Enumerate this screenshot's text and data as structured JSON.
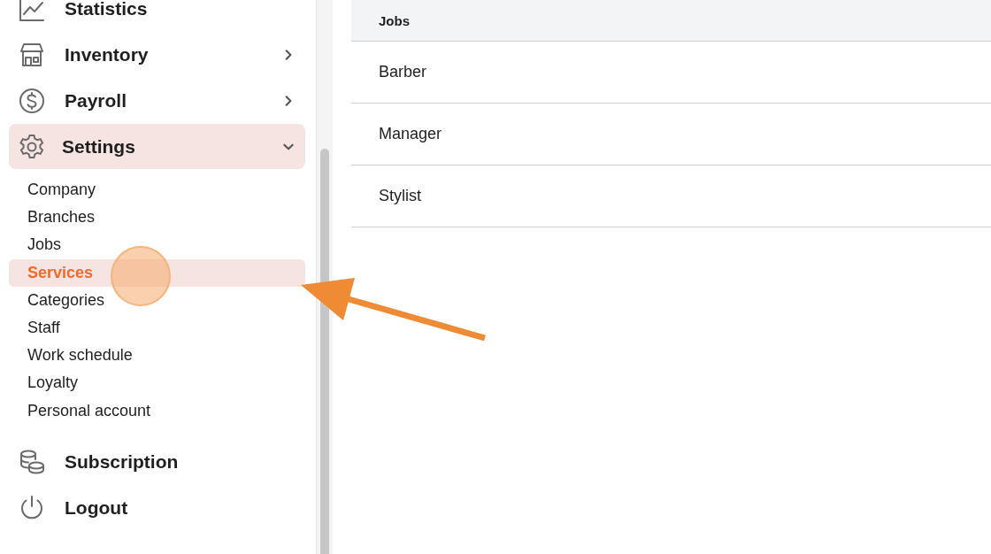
{
  "sidebar": {
    "items": [
      {
        "label": "Statistics"
      },
      {
        "label": "Inventory",
        "expanded": false
      },
      {
        "label": "Payroll",
        "expanded": false
      },
      {
        "label": "Settings",
        "expanded": true,
        "children": [
          {
            "label": "Company",
            "selected": false
          },
          {
            "label": "Branches",
            "selected": false
          },
          {
            "label": "Jobs",
            "selected": false
          },
          {
            "label": "Services",
            "selected": true
          },
          {
            "label": "Categories",
            "selected": false
          },
          {
            "label": "Staff",
            "selected": false
          },
          {
            "label": "Work schedule",
            "selected": false
          },
          {
            "label": "Loyalty",
            "selected": false
          },
          {
            "label": "Personal account",
            "selected": false
          }
        ]
      },
      {
        "label": "Subscription"
      },
      {
        "label": "Logout"
      }
    ]
  },
  "table": {
    "columns": [
      "Jobs"
    ],
    "rows": [
      [
        "Barber"
      ],
      [
        "Manager"
      ],
      [
        "Stylist"
      ]
    ]
  }
}
